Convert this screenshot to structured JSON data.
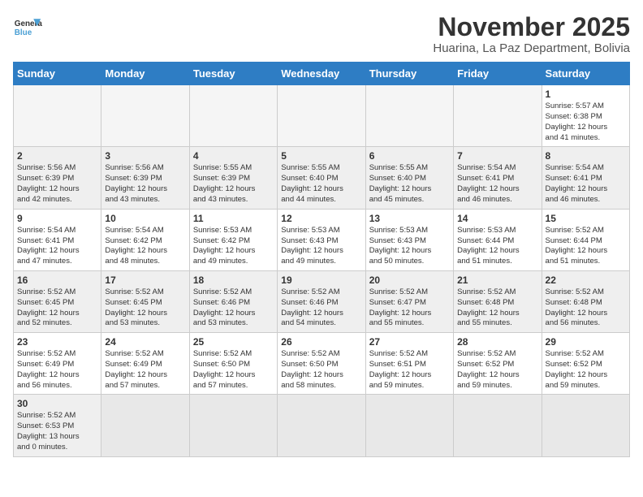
{
  "logo": {
    "text_general": "General",
    "text_blue": "Blue"
  },
  "title": "November 2025",
  "location": "Huarina, La Paz Department, Bolivia",
  "days_of_week": [
    "Sunday",
    "Monday",
    "Tuesday",
    "Wednesday",
    "Thursday",
    "Friday",
    "Saturday"
  ],
  "weeks": [
    [
      {
        "day": "",
        "info": ""
      },
      {
        "day": "",
        "info": ""
      },
      {
        "day": "",
        "info": ""
      },
      {
        "day": "",
        "info": ""
      },
      {
        "day": "",
        "info": ""
      },
      {
        "day": "",
        "info": ""
      },
      {
        "day": "1",
        "info": "Sunrise: 5:57 AM\nSunset: 6:38 PM\nDaylight: 12 hours\nand 41 minutes."
      }
    ],
    [
      {
        "day": "2",
        "info": "Sunrise: 5:56 AM\nSunset: 6:39 PM\nDaylight: 12 hours\nand 42 minutes."
      },
      {
        "day": "3",
        "info": "Sunrise: 5:56 AM\nSunset: 6:39 PM\nDaylight: 12 hours\nand 43 minutes."
      },
      {
        "day": "4",
        "info": "Sunrise: 5:55 AM\nSunset: 6:39 PM\nDaylight: 12 hours\nand 43 minutes."
      },
      {
        "day": "5",
        "info": "Sunrise: 5:55 AM\nSunset: 6:40 PM\nDaylight: 12 hours\nand 44 minutes."
      },
      {
        "day": "6",
        "info": "Sunrise: 5:55 AM\nSunset: 6:40 PM\nDaylight: 12 hours\nand 45 minutes."
      },
      {
        "day": "7",
        "info": "Sunrise: 5:54 AM\nSunset: 6:41 PM\nDaylight: 12 hours\nand 46 minutes."
      },
      {
        "day": "8",
        "info": "Sunrise: 5:54 AM\nSunset: 6:41 PM\nDaylight: 12 hours\nand 46 minutes."
      }
    ],
    [
      {
        "day": "9",
        "info": "Sunrise: 5:54 AM\nSunset: 6:41 PM\nDaylight: 12 hours\nand 47 minutes."
      },
      {
        "day": "10",
        "info": "Sunrise: 5:54 AM\nSunset: 6:42 PM\nDaylight: 12 hours\nand 48 minutes."
      },
      {
        "day": "11",
        "info": "Sunrise: 5:53 AM\nSunset: 6:42 PM\nDaylight: 12 hours\nand 49 minutes."
      },
      {
        "day": "12",
        "info": "Sunrise: 5:53 AM\nSunset: 6:43 PM\nDaylight: 12 hours\nand 49 minutes."
      },
      {
        "day": "13",
        "info": "Sunrise: 5:53 AM\nSunset: 6:43 PM\nDaylight: 12 hours\nand 50 minutes."
      },
      {
        "day": "14",
        "info": "Sunrise: 5:53 AM\nSunset: 6:44 PM\nDaylight: 12 hours\nand 51 minutes."
      },
      {
        "day": "15",
        "info": "Sunrise: 5:52 AM\nSunset: 6:44 PM\nDaylight: 12 hours\nand 51 minutes."
      }
    ],
    [
      {
        "day": "16",
        "info": "Sunrise: 5:52 AM\nSunset: 6:45 PM\nDaylight: 12 hours\nand 52 minutes."
      },
      {
        "day": "17",
        "info": "Sunrise: 5:52 AM\nSunset: 6:45 PM\nDaylight: 12 hours\nand 53 minutes."
      },
      {
        "day": "18",
        "info": "Sunrise: 5:52 AM\nSunset: 6:46 PM\nDaylight: 12 hours\nand 53 minutes."
      },
      {
        "day": "19",
        "info": "Sunrise: 5:52 AM\nSunset: 6:46 PM\nDaylight: 12 hours\nand 54 minutes."
      },
      {
        "day": "20",
        "info": "Sunrise: 5:52 AM\nSunset: 6:47 PM\nDaylight: 12 hours\nand 55 minutes."
      },
      {
        "day": "21",
        "info": "Sunrise: 5:52 AM\nSunset: 6:48 PM\nDaylight: 12 hours\nand 55 minutes."
      },
      {
        "day": "22",
        "info": "Sunrise: 5:52 AM\nSunset: 6:48 PM\nDaylight: 12 hours\nand 56 minutes."
      }
    ],
    [
      {
        "day": "23",
        "info": "Sunrise: 5:52 AM\nSunset: 6:49 PM\nDaylight: 12 hours\nand 56 minutes."
      },
      {
        "day": "24",
        "info": "Sunrise: 5:52 AM\nSunset: 6:49 PM\nDaylight: 12 hours\nand 57 minutes."
      },
      {
        "day": "25",
        "info": "Sunrise: 5:52 AM\nSunset: 6:50 PM\nDaylight: 12 hours\nand 57 minutes."
      },
      {
        "day": "26",
        "info": "Sunrise: 5:52 AM\nSunset: 6:50 PM\nDaylight: 12 hours\nand 58 minutes."
      },
      {
        "day": "27",
        "info": "Sunrise: 5:52 AM\nSunset: 6:51 PM\nDaylight: 12 hours\nand 59 minutes."
      },
      {
        "day": "28",
        "info": "Sunrise: 5:52 AM\nSunset: 6:52 PM\nDaylight: 12 hours\nand 59 minutes."
      },
      {
        "day": "29",
        "info": "Sunrise: 5:52 AM\nSunset: 6:52 PM\nDaylight: 12 hours\nand 59 minutes."
      }
    ],
    [
      {
        "day": "30",
        "info": "Sunrise: 5:52 AM\nSunset: 6:53 PM\nDaylight: 13 hours\nand 0 minutes."
      },
      {
        "day": "",
        "info": ""
      },
      {
        "day": "",
        "info": ""
      },
      {
        "day": "",
        "info": ""
      },
      {
        "day": "",
        "info": ""
      },
      {
        "day": "",
        "info": ""
      },
      {
        "day": "",
        "info": ""
      }
    ]
  ]
}
